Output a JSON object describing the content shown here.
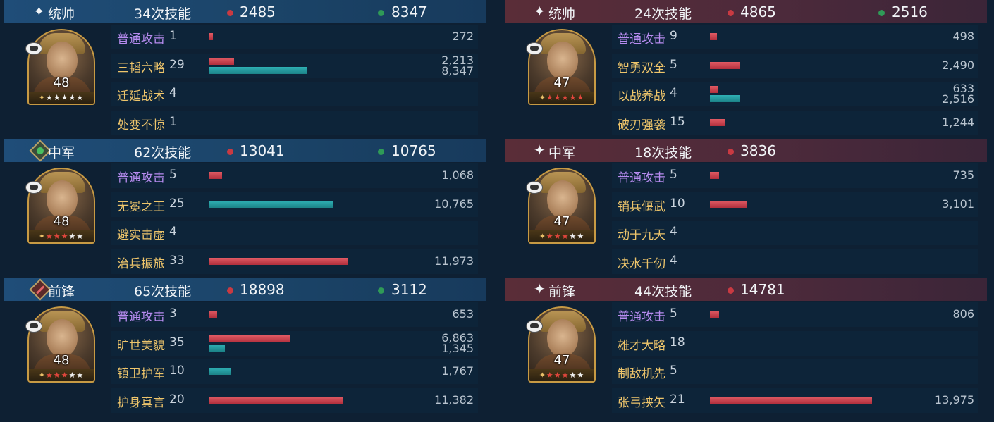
{
  "left": {
    "sections": [
      {
        "role": "统帅",
        "role_icon": "star-icon",
        "skill_count": "34次技能",
        "red_total": "2485",
        "green_total": "8347",
        "hero": {
          "level": "48",
          "stars": [
            "gold",
            "white",
            "white",
            "white",
            "white",
            "white"
          ]
        },
        "skills": [
          {
            "name": "普通攻击",
            "count": "1",
            "type": "purple",
            "red": 0.015,
            "teal": 0,
            "v1": "272",
            "v2": ""
          },
          {
            "name": "三韬六略",
            "count": "29",
            "type": "gold",
            "red": 0.11,
            "teal": 0.43,
            "v1": "2,213",
            "v2": "8,347"
          },
          {
            "name": "迁延战术",
            "count": "4",
            "type": "gold",
            "red": 0,
            "teal": 0,
            "v1": "",
            "v2": ""
          },
          {
            "name": "处变不惊",
            "count": "1",
            "type": "gold",
            "red": 0,
            "teal": 0,
            "v1": "",
            "v2": ""
          }
        ]
      },
      {
        "role": "中军",
        "role_icon": "heart-icon",
        "skill_count": "62次技能",
        "red_total": "13041",
        "green_total": "10765",
        "hero": {
          "level": "48",
          "stars": [
            "gold",
            "red",
            "red",
            "red",
            "white",
            "white"
          ]
        },
        "skills": [
          {
            "name": "普通攻击",
            "count": "5",
            "type": "purple",
            "red": 0.055,
            "teal": 0,
            "v1": "1,068",
            "v2": ""
          },
          {
            "name": "无冕之王",
            "count": "25",
            "type": "gold",
            "red": 0,
            "teal": 0.55,
            "v1": "10,765",
            "v2": ""
          },
          {
            "name": "避实击虚",
            "count": "4",
            "type": "gold",
            "red": 0,
            "teal": 0,
            "v1": "",
            "v2": ""
          },
          {
            "name": "治兵振旅",
            "count": "33",
            "type": "gold",
            "red": 0.615,
            "teal": 0,
            "v1": "11,973",
            "v2": ""
          }
        ]
      },
      {
        "role": "前锋",
        "role_icon": "sword-icon",
        "skill_count": "65次技能",
        "red_total": "18898",
        "green_total": "3112",
        "hero": {
          "level": "48",
          "stars": [
            "gold",
            "red",
            "red",
            "red",
            "white",
            "white"
          ]
        },
        "skills": [
          {
            "name": "普通攻击",
            "count": "3",
            "type": "purple",
            "red": 0.035,
            "teal": 0,
            "v1": "653",
            "v2": ""
          },
          {
            "name": "旷世美貌",
            "count": "35",
            "type": "gold",
            "red": 0.355,
            "teal": 0.07,
            "v1": "6,863",
            "v2": "1,345"
          },
          {
            "name": "镇卫护军",
            "count": "10",
            "type": "gold",
            "red": 0,
            "teal": 0.095,
            "v1": "1,767",
            "v2": ""
          },
          {
            "name": "护身真言",
            "count": "20",
            "type": "gold",
            "red": 0.59,
            "teal": 0,
            "v1": "11,382",
            "v2": ""
          }
        ]
      }
    ]
  },
  "right": {
    "sections": [
      {
        "role": "统帅",
        "role_icon": "star-icon",
        "skill_count": "24次技能",
        "red_total": "4865",
        "green_total": "2516",
        "hero": {
          "level": "47",
          "stars": [
            "gold",
            "red",
            "red",
            "red",
            "red",
            "red"
          ]
        },
        "skills": [
          {
            "name": "普通攻击",
            "count": "9",
            "type": "purple",
            "red": 0.03,
            "teal": 0,
            "v1": "498",
            "v2": ""
          },
          {
            "name": "智勇双全",
            "count": "5",
            "type": "gold",
            "red": 0.13,
            "teal": 0,
            "v1": "2,490",
            "v2": ""
          },
          {
            "name": "以战养战",
            "count": "4",
            "type": "gold",
            "red": 0.035,
            "teal": 0.13,
            "v1": "633",
            "v2": "2,516"
          },
          {
            "name": "破刃强袭",
            "count": "15",
            "type": "gold",
            "red": 0.065,
            "teal": 0,
            "v1": "1,244",
            "v2": ""
          }
        ]
      },
      {
        "role": "中军",
        "role_icon": "star-icon",
        "skill_count": "18次技能",
        "red_total": "3836",
        "green_total": "",
        "hero": {
          "level": "47",
          "stars": [
            "gold",
            "red",
            "red",
            "red",
            "white",
            "white"
          ]
        },
        "skills": [
          {
            "name": "普通攻击",
            "count": "5",
            "type": "purple",
            "red": 0.04,
            "teal": 0,
            "v1": "735",
            "v2": ""
          },
          {
            "name": "销兵偃武",
            "count": "10",
            "type": "gold",
            "red": 0.165,
            "teal": 0,
            "v1": "3,101",
            "v2": ""
          },
          {
            "name": "动于九天",
            "count": "4",
            "type": "gold",
            "red": 0,
            "teal": 0,
            "v1": "",
            "v2": ""
          },
          {
            "name": "决水千仞",
            "count": "4",
            "type": "gold",
            "red": 0,
            "teal": 0,
            "v1": "",
            "v2": ""
          }
        ]
      },
      {
        "role": "前锋",
        "role_icon": "star-icon",
        "skill_count": "44次技能",
        "red_total": "14781",
        "green_total": "",
        "hero": {
          "level": "47",
          "stars": [
            "gold",
            "red",
            "red",
            "red",
            "white",
            "white"
          ]
        },
        "skills": [
          {
            "name": "普通攻击",
            "count": "5",
            "type": "purple",
            "red": 0.04,
            "teal": 0,
            "v1": "806",
            "v2": ""
          },
          {
            "name": "雄才大略",
            "count": "18",
            "type": "gold",
            "red": 0,
            "teal": 0,
            "v1": "",
            "v2": ""
          },
          {
            "name": "制敌机先",
            "count": "5",
            "type": "gold",
            "red": 0,
            "teal": 0,
            "v1": "",
            "v2": ""
          },
          {
            "name": "张弓挟矢",
            "count": "21",
            "type": "gold",
            "red": 0.72,
            "teal": 0,
            "v1": "13,975",
            "v2": ""
          }
        ]
      }
    ]
  },
  "colors": {
    "left_header": "#1f4d78",
    "right_header": "#5a2d38",
    "red_bar": "#c93a42",
    "teal_bar": "#25999d",
    "basic_skill": "#b78cf0",
    "skill_name": "#eec56b"
  }
}
